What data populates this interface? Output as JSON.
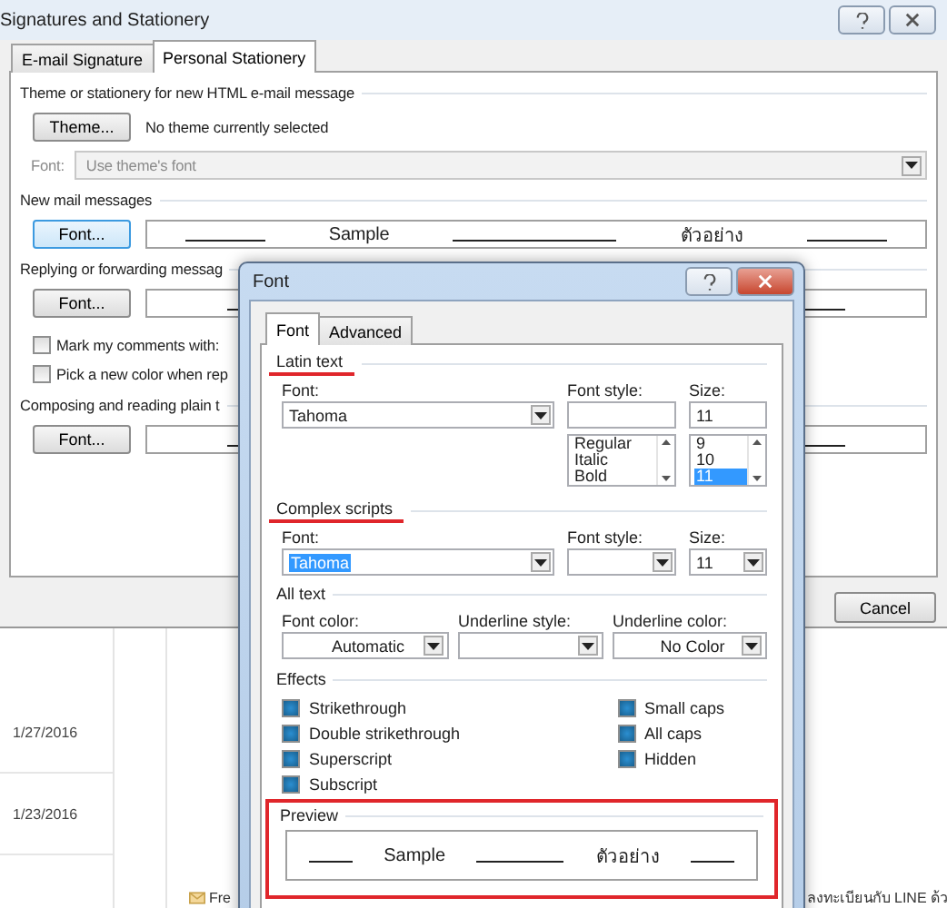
{
  "back_window": {
    "title": "Signatures and Stationery",
    "tabs": [
      {
        "label": "E-mail Signature",
        "selected": false
      },
      {
        "label": "Personal Stationery",
        "selected": true
      }
    ],
    "theme_section": {
      "heading": "Theme or stationery for new HTML e-mail message",
      "button": "Theme...",
      "status": "No theme currently selected",
      "font_label": "Font:",
      "font_value": "Use theme's font",
      "disabled": true
    },
    "sections": [
      {
        "heading": "New mail messages",
        "button": "Font...",
        "sample": "Sample",
        "sample_thai": "ตัวอย่าง"
      },
      {
        "heading": "Replying or forwarding messag",
        "button": "Font...",
        "checkboxes": [
          {
            "label": "Mark my comments with:",
            "checked": false
          },
          {
            "label": "Pick a new color when rep",
            "checked": false
          }
        ]
      },
      {
        "heading": "Composing and reading plain t",
        "button": "Font..."
      }
    ],
    "buttons": [
      "Cancel"
    ]
  },
  "mail_list": {
    "dates": [
      "1/27/2016",
      "1/23/2016"
    ],
    "snippet": "Fre",
    "thai_snippet": "ลงทะเบียนกับ LINE ด้ว"
  },
  "font_dialog": {
    "title": "Font",
    "tabs": [
      {
        "label": "Font",
        "selected": true
      },
      {
        "label": "Advanced",
        "selected": false
      }
    ],
    "latin": {
      "heading": "Latin text",
      "highlighted": true,
      "font_label": "Font:",
      "font": "Tahoma",
      "style_label": "Font style:",
      "styles": [
        {
          "label": "Regular",
          "selected": false
        },
        {
          "label": "Italic",
          "selected": false
        },
        {
          "label": "Bold",
          "selected": false
        }
      ],
      "size_label": "Size:",
      "size": "11",
      "sizes": [
        {
          "label": "9",
          "selected": false
        },
        {
          "label": "10",
          "selected": false
        },
        {
          "label": "11",
          "selected": true
        }
      ]
    },
    "complex": {
      "heading": "Complex scripts",
      "highlighted": true,
      "font_label": "Font:",
      "font": "Tahoma",
      "font_selected": true,
      "style_label": "Font style:",
      "size_label": "Size:",
      "size": "11"
    },
    "all_text": {
      "heading": "All text",
      "fields": [
        {
          "label": "Font color:",
          "value": "Automatic"
        },
        {
          "label": "Underline style:"
        },
        {
          "label": "Underline color:",
          "value": "No Color"
        }
      ]
    },
    "effects": {
      "heading": "Effects",
      "left": [
        {
          "label": "Strikethrough",
          "indeterminate": true
        },
        {
          "label": "Double strikethrough",
          "indeterminate": true
        },
        {
          "label": "Superscript",
          "indeterminate": true
        },
        {
          "label": "Subscript",
          "indeterminate": true
        }
      ],
      "right": [
        {
          "label": "Small caps",
          "indeterminate": true
        },
        {
          "label": "All caps",
          "indeterminate": true
        },
        {
          "label": "Hidden",
          "indeterminate": true
        }
      ]
    },
    "preview": {
      "heading": "Preview",
      "highlighted": true,
      "sample": "Sample",
      "sample_thai": "ตัวอย่าง"
    }
  }
}
